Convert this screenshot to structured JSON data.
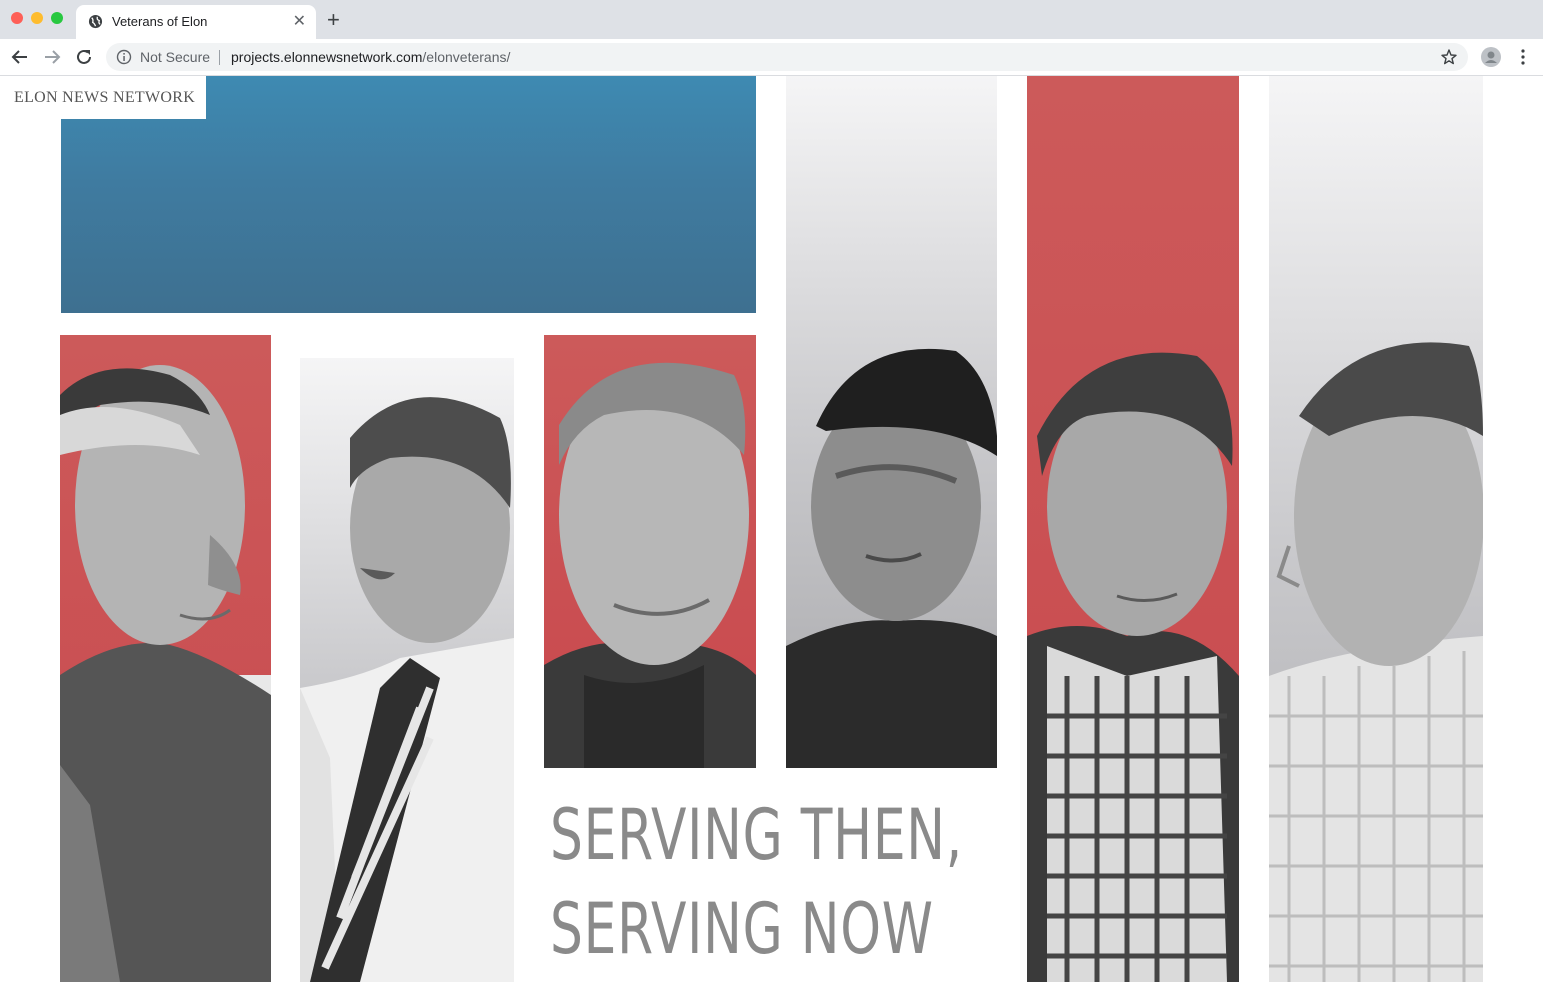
{
  "browser": {
    "tab_title": "Veterans of Elon",
    "security_label": "Not Secure",
    "url_host": "projects.elonnewsnetwork.com",
    "url_path": "/elonveterans/"
  },
  "page": {
    "brand": "ELON NEWS NETWORK",
    "headline_line1": "SERVING THEN,",
    "headline_line2": "SERVING NOW",
    "colors": {
      "blue": "#3f7ba0",
      "red": "#c9484d",
      "text_gray": "#8a8a8a"
    }
  }
}
